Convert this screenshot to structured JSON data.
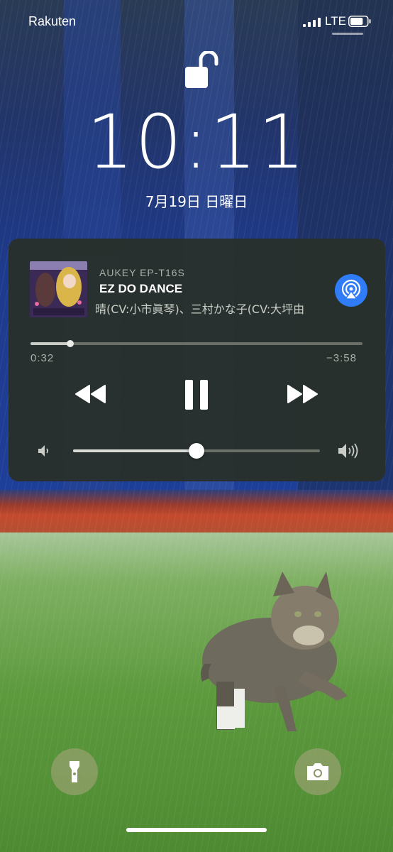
{
  "status_bar": {
    "carrier": "Rakuten",
    "network": "LTE",
    "battery_level": 0.75
  },
  "lock_screen": {
    "time": "10:11",
    "date": "7月19日 日曜日",
    "lock_state": "unlocked"
  },
  "now_playing": {
    "source": "AUKEY EP-T16S",
    "title": "EZ DO DANCE",
    "artist": "晴(CV:小市眞琴)、三村かな子(CV:大坪由",
    "elapsed": "0:32",
    "remaining": "−3:58",
    "progress": 0.12,
    "volume": 0.5,
    "accent_color": "#2f7cf6"
  },
  "icons": [
    "lock-open-icon",
    "airplay-icon",
    "rewind-icon",
    "pause-icon",
    "fast-forward-icon",
    "volume-low-icon",
    "volume-high-icon",
    "flashlight-icon",
    "camera-icon"
  ]
}
